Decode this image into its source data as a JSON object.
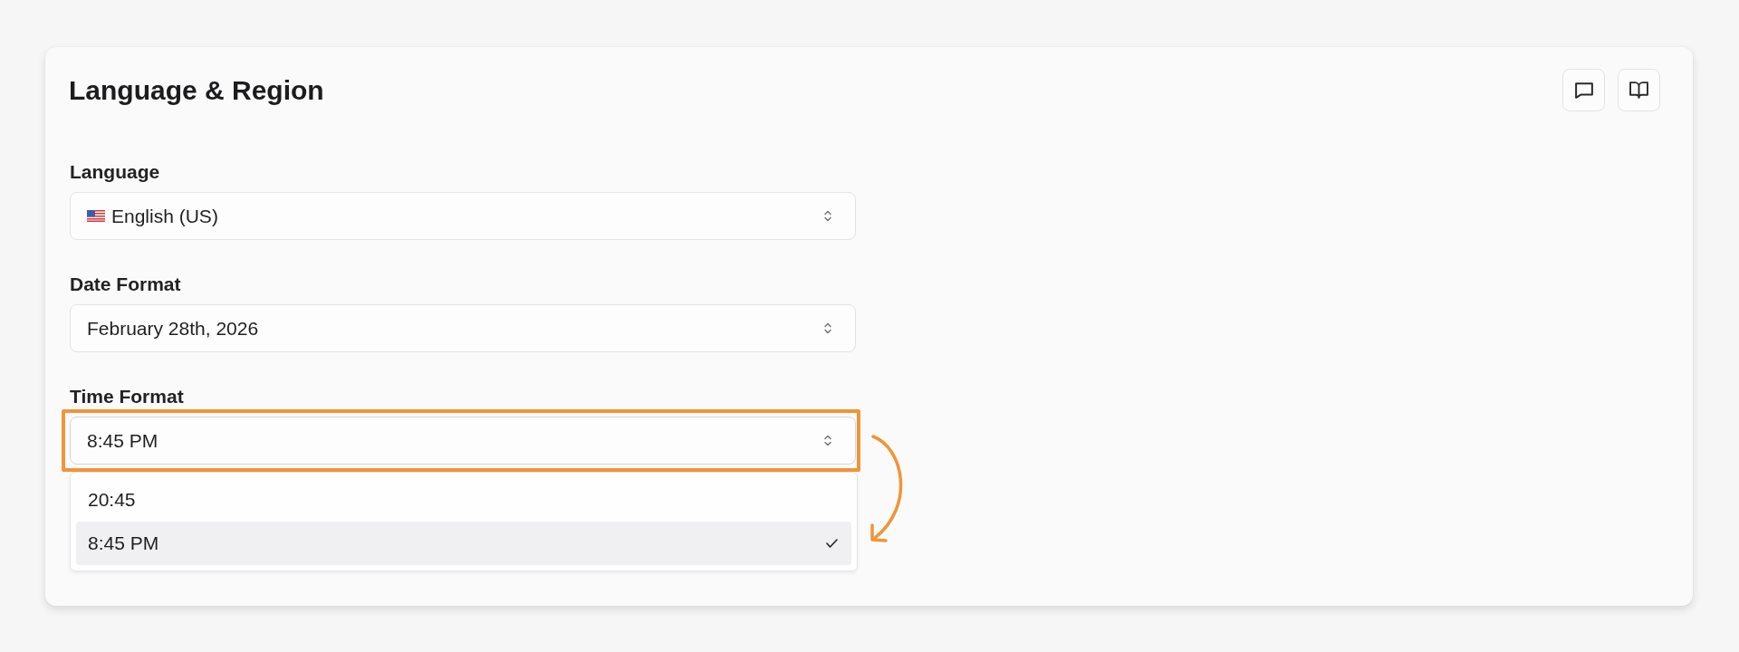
{
  "title": "Language & Region",
  "actions": [
    {
      "kind": "comment"
    },
    {
      "kind": "book"
    }
  ],
  "fields": [
    {
      "kind": "language",
      "label": "Language",
      "value": "English (US)",
      "expanded": false
    },
    {
      "kind": "select",
      "label": "Date Format",
      "value": "February 28th, 2026",
      "expanded": false
    },
    {
      "kind": "select",
      "label": "Time Format",
      "value": "8:45 PM",
      "expanded": true,
      "highlighted": true,
      "options": [
        {
          "label": "20:45",
          "selected": false
        },
        {
          "label": "8:45 PM",
          "selected": true
        }
      ]
    }
  ]
}
